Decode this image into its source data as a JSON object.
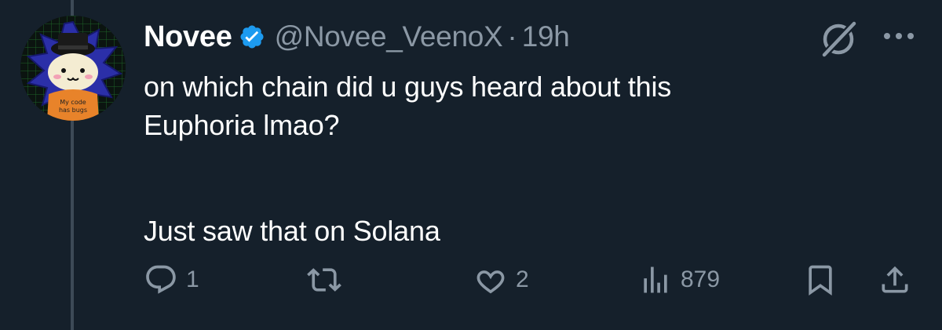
{
  "author": {
    "display_name": "Novee",
    "handle": "@Novee_VeenoX",
    "separator": "·",
    "time": "19h",
    "verified": true,
    "avatar_text": [
      "My code",
      "has bugs"
    ]
  },
  "tweet": {
    "lines": [
      "on which chain did u guys heard about this",
      "Euphoria lmao?",
      "Just saw that on Solana"
    ]
  },
  "actions": {
    "reply_count": "1",
    "retweet_count": "",
    "like_count": "2",
    "views_count": "879"
  },
  "icons": {
    "verified": "verified-badge-icon",
    "grok": "grok-icon",
    "more": "more-icon",
    "reply": "reply-icon",
    "retweet": "retweet-icon",
    "like": "heart-icon",
    "views": "views-icon",
    "bookmark": "bookmark-icon",
    "share": "share-icon"
  },
  "colors": {
    "background": "#15202b",
    "text": "#ffffff",
    "muted": "#8b98a5",
    "accent": "#1d9bf0"
  }
}
